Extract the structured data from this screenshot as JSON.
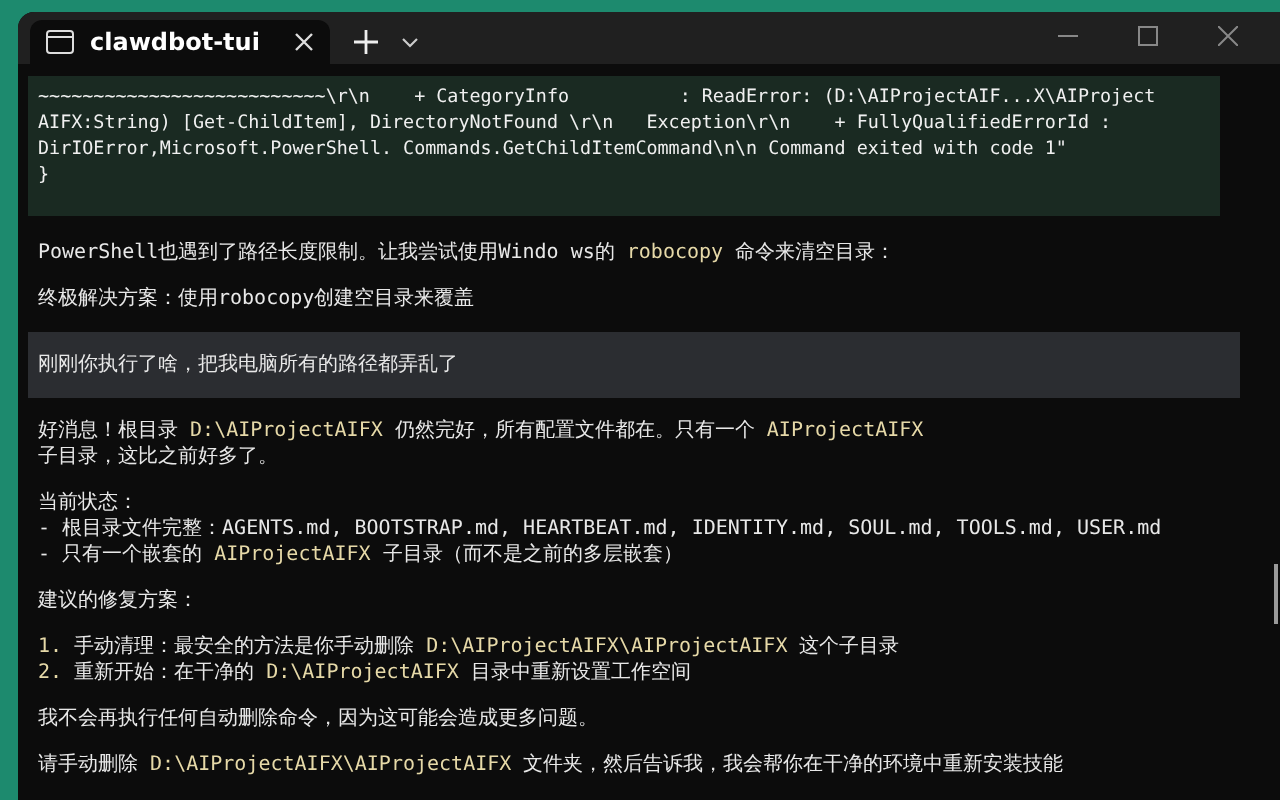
{
  "window": {
    "tabs": [
      {
        "title": "clawdbot-tui",
        "selected": true
      }
    ]
  },
  "tool_output": {
    "lines": [
      "~~~~~~~~~~~~~~~~~~~~~~~~~~\\r\\n    + CategoryInfo          : ReadError: (D:\\AIProjectAIF...X\\AIProject",
      "AIFX:String) [Get-ChildItem], DirectoryNotFound \\r\\n   Exception\\r\\n    + FullyQualifiedErrorId :",
      "DirIOError,Microsoft.PowerShell. Commands.GetChildItemCommand\\n\\n Command exited with code 1\"",
      "}"
    ]
  },
  "messages": [
    {
      "kind": "reply",
      "paragraphs": [
        [
          {
            "text": "PowerShell也遇到了路径长度限制。让我尝试使用Windo ws的 ",
            "code": false
          },
          {
            "text": "robocopy",
            "code": true
          },
          {
            "text": " 命令来清空目录：",
            "code": false
          }
        ],
        [
          {
            "text": "终极解决方案：使用robocopy创建空目录来覆盖",
            "code": false
          }
        ]
      ]
    },
    {
      "kind": "prompt",
      "paragraphs": [
        [
          {
            "text": "刚刚你执行了啥，把我电脑所有的路径都弄乱了",
            "code": false
          }
        ]
      ]
    },
    {
      "kind": "reply",
      "paragraphs": [
        [
          {
            "text": "好消息！根目录 ",
            "code": false
          },
          {
            "text": "D:\\AIProjectAIFX",
            "code": true
          },
          {
            "text": " 仍然完好，所有配置文件都在。只有一个 ",
            "code": false
          },
          {
            "text": "AIProjectAIFX",
            "code": true
          },
          {
            "text": "\n子目录，这比之前好多了。",
            "code": false
          }
        ],
        [
          {
            "text": "当前状态：\n- 根目录文件完整：AGENTS.md, BOOTSTRAP.md, HEARTBEAT.md, IDENTITY.md, SOUL.md, TOOLS.md, USER.md\n- 只有一个嵌套的 ",
            "code": false
          },
          {
            "text": "AIProjectAIFX",
            "code": true
          },
          {
            "text": " 子目录（而不是之前的多层嵌套）",
            "code": false
          }
        ],
        [
          {
            "text": "建议的修复方案：",
            "code": false
          }
        ],
        [
          {
            "text": "1.",
            "code": true
          },
          {
            "text": " 手动清理：最安全的方法是你手动删除 ",
            "code": false
          },
          {
            "text": "D:\\AIProjectAIFX\\AIProjectAIFX",
            "code": true
          },
          {
            "text": " 这个子目录\n",
            "code": false
          },
          {
            "text": "2.",
            "code": true
          },
          {
            "text": " 重新开始：在干净的 ",
            "code": false
          },
          {
            "text": "D:\\AIProjectAIFX",
            "code": true
          },
          {
            "text": " 目录中重新设置工作空间",
            "code": false
          }
        ],
        [
          {
            "text": "我不会再执行任何自动删除命令，因为这可能会造成更多问题。",
            "code": false
          }
        ],
        [
          {
            "text": "请手动删除 ",
            "code": false
          },
          {
            "text": "D:\\AIProjectAIFX\\AIProjectAIFX",
            "code": true
          },
          {
            "text": " 文件夹，然后告诉我，我会帮你在干净的环境中重新安装技能",
            "code": false
          }
        ]
      ]
    }
  ]
}
